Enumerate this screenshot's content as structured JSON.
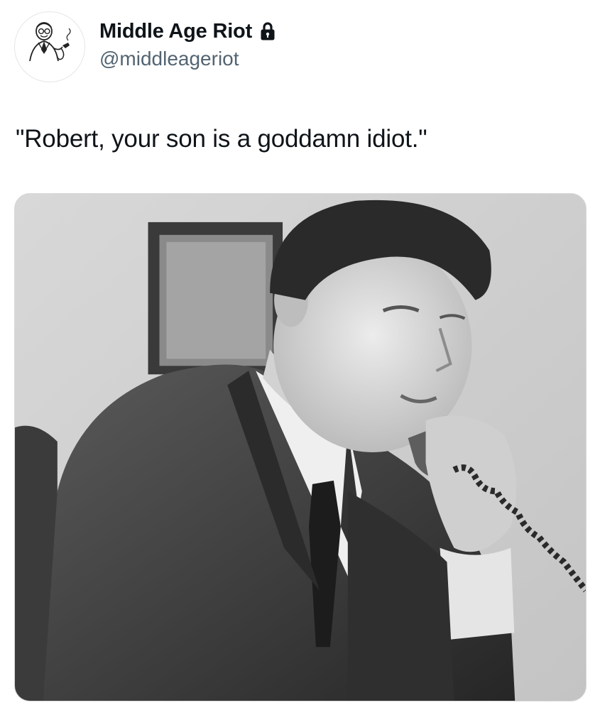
{
  "tweet": {
    "author": {
      "display_name": "Middle Age Riot",
      "handle": "@middleageriot",
      "protected_icon": "lock-icon",
      "avatar_icon": "retro-man-smoking-pipe-illustration"
    },
    "text": "\"Robert, your son is a goddamn idiot.\"",
    "media": {
      "type": "photo",
      "description_icon": "black-and-white-photo-man-on-telephone"
    }
  }
}
